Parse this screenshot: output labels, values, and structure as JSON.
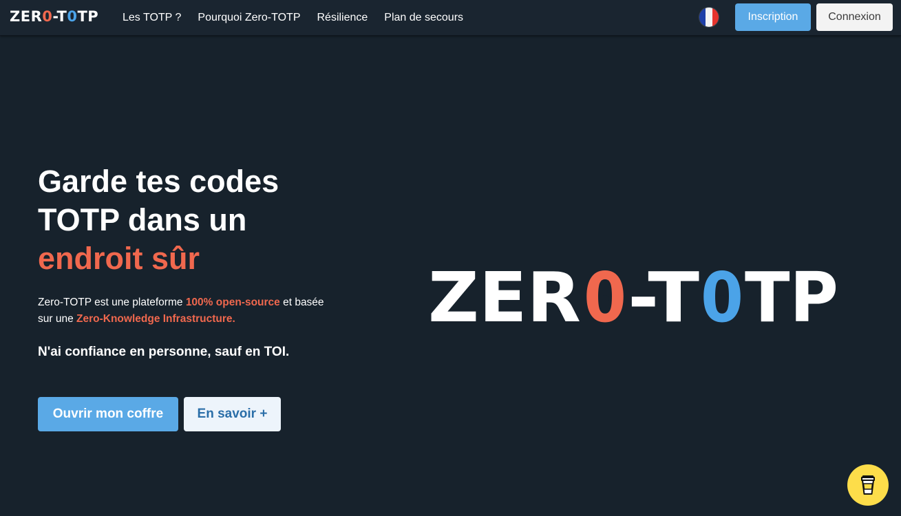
{
  "navbar": {
    "brand": {
      "z": "ZER",
      "o1": "0",
      "dash": "-T",
      "o2": "0",
      "rest": "TP"
    },
    "links": [
      "Les TOTP ?",
      "Pourquoi Zero-TOTP",
      "Résilience",
      "Plan de secours"
    ],
    "language_icon": "france-flag-icon",
    "signup_label": "Inscription",
    "login_label": "Connexion"
  },
  "hero": {
    "title_line1": "Garde tes codes",
    "title_line2": "TOTP dans un",
    "title_accent": "endroit sûr",
    "desc_part1": "Zero-TOTP est une plateforme ",
    "desc_hl1": "100% open-source",
    "desc_part2": " et basée sur une ",
    "desc_hl2": "Zero-Knowledge Infrastructure.",
    "trust": "N'ai confiance en personne, sauf en TOI.",
    "open_button": "Ouvrir mon coffre",
    "more_button": "En savoir +"
  },
  "big_logo": {
    "zer": "ZER",
    "o1": "0",
    "dash_t": "-T",
    "o2": "0",
    "tp": "TP"
  },
  "colors": {
    "background": "#17222c",
    "accent_red": "#f0684e",
    "accent_blue": "#5aa9e6",
    "coffee_yellow": "#fddd4a"
  },
  "floating": {
    "coffee_icon": "coffee-cup-icon"
  }
}
